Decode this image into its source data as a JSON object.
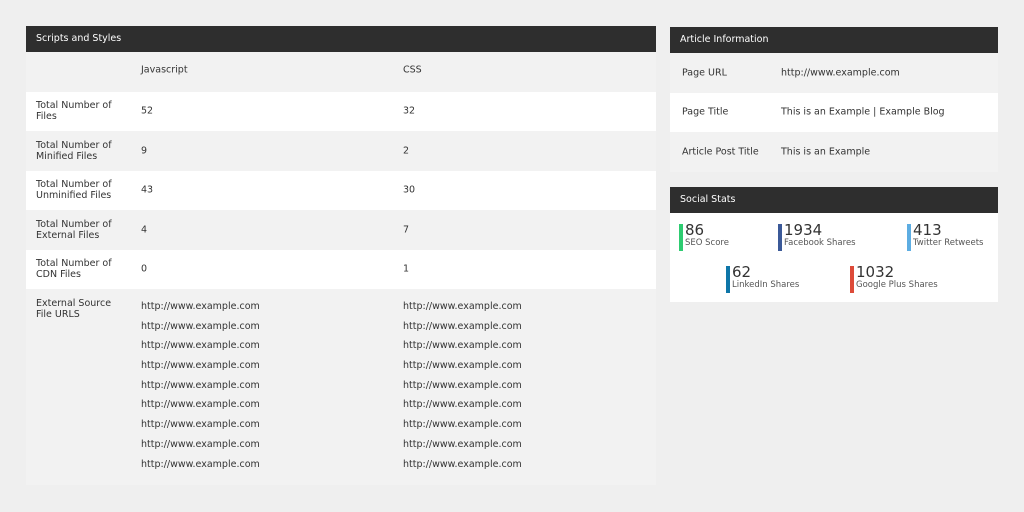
{
  "scripts_panel": {
    "title": "Scripts and Styles",
    "columns": {
      "js": "Javascript",
      "css": "CSS"
    },
    "rows": [
      {
        "label": "Total Number of Files",
        "js": "52",
        "css": "32"
      },
      {
        "label": "Total Number of Minified Files",
        "js": "9",
        "css": "2"
      },
      {
        "label": "Total Number of Unminified Files",
        "js": "43",
        "css": "30"
      },
      {
        "label": "Total Number of External Files",
        "js": "4",
        "css": "7"
      },
      {
        "label": "Total Number of CDN Files",
        "js": "0",
        "css": "1"
      }
    ],
    "external": {
      "label": "External Source File URLS",
      "js_urls": [
        "http://www.example.com",
        "http://www.example.com",
        "http://www.example.com",
        "http://www.example.com",
        "http://www.example.com",
        "http://www.example.com",
        "http://www.example.com",
        "http://www.example.com",
        "http://www.example.com"
      ],
      "css_urls": [
        "http://www.example.com",
        "http://www.example.com",
        "http://www.example.com",
        "http://www.example.com",
        "http://www.example.com",
        "http://www.example.com",
        "http://www.example.com",
        "http://www.example.com",
        "http://www.example.com"
      ]
    }
  },
  "article_panel": {
    "title": "Article Information",
    "rows": [
      {
        "label": "Page URL",
        "value": "http://www.example.com"
      },
      {
        "label": "Page Title",
        "value": "This is an Example | Example Blog"
      },
      {
        "label": "Article Post Title",
        "value": "This is an Example"
      }
    ]
  },
  "social_panel": {
    "title": "Social Stats",
    "stats": [
      {
        "value": "86",
        "label": "SEO Score",
        "color": "#2ecc71",
        "icon": "seo-icon"
      },
      {
        "value": "1934",
        "label": "Facebook Shares",
        "color": "#3b5998",
        "icon": "facebook-icon"
      },
      {
        "value": "413",
        "label": "Twitter Retweets",
        "color": "#5dade2",
        "icon": "twitter-icon"
      },
      {
        "value": "62",
        "label": "LinkedIn Shares",
        "color": "#0e76a8",
        "icon": "linkedin-icon"
      },
      {
        "value": "1032",
        "label": "Google Plus Shares",
        "color": "#dd4b39",
        "icon": "google-plus-icon"
      }
    ]
  }
}
